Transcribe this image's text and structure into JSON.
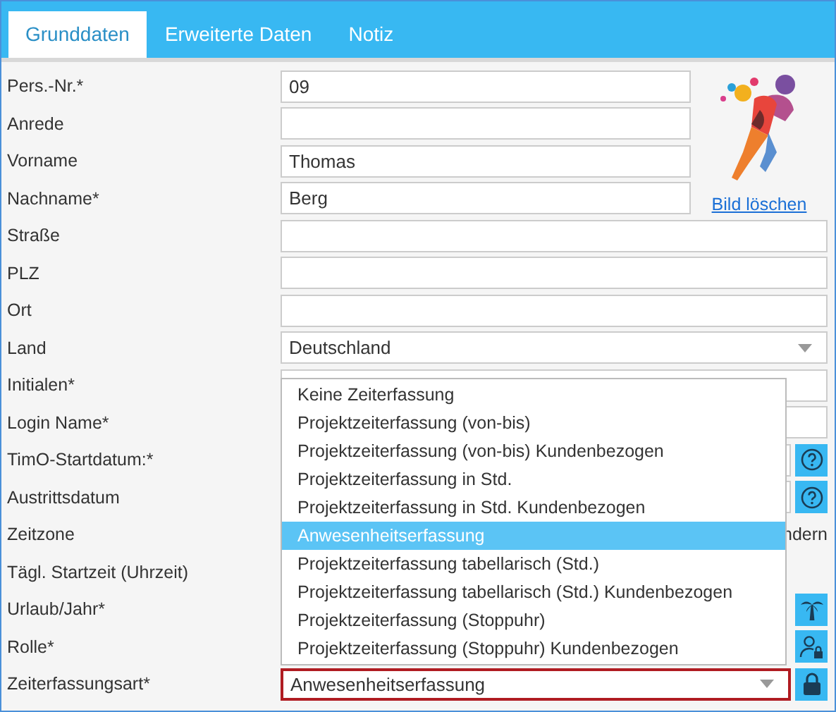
{
  "tabs": [
    {
      "label": "Grunddaten",
      "selected": true
    },
    {
      "label": "Erweiterte Daten",
      "selected": false
    },
    {
      "label": "Notiz",
      "selected": false
    }
  ],
  "header_fields": [
    {
      "label": "Pers.-Nr.*",
      "kind": "text",
      "value": "09"
    },
    {
      "label": "Anrede",
      "kind": "text"
    },
    {
      "label": "Vorname",
      "kind": "text",
      "value": "Thomas"
    },
    {
      "label": "Nachname*",
      "kind": "text",
      "value": "Berg"
    }
  ],
  "photo": {
    "kind": "picture",
    "link": "Bild löschen"
  },
  "fields": [
    {
      "label": "Straße",
      "kind": "text"
    },
    {
      "label": "PLZ",
      "kind": "text"
    },
    {
      "label": "Ort",
      "kind": "text"
    },
    {
      "label": "Land",
      "kind": "select",
      "value": "Deutschland"
    },
    {
      "label": "Initialen*",
      "kind": "text"
    },
    {
      "label": "Login Name*",
      "kind": "text"
    },
    {
      "label": "TimO-Startdatum:*",
      "kind": "text",
      "button": {
        "kind": "help"
      }
    },
    {
      "label": "Austrittsdatum",
      "kind": "text",
      "button": {
        "kind": "help"
      }
    },
    {
      "label": "Zeitzone",
      "kind": "note",
      "note": "ndern"
    },
    {
      "label": "Tägl. Startzeit (Uhrzeit)",
      "kind": "empty"
    },
    {
      "label": "Urlaub/Jahr*",
      "kind": "empty",
      "button": {
        "kind": "palm"
      }
    },
    {
      "label": "Rolle*",
      "kind": "empty",
      "button": {
        "kind": "user-lock"
      }
    },
    {
      "label": "Zeiterfassungsart*",
      "kind": "select",
      "value": "Anwesenheitserfassung",
      "focused": true,
      "button": {
        "kind": "lock"
      },
      "dropdown": [
        {
          "label": "Keine Zeiterfassung",
          "selected": false
        },
        {
          "label": "Projektzeiterfassung (von-bis)",
          "selected": false
        },
        {
          "label": "Projektzeiterfassung (von-bis) Kundenbezogen",
          "selected": false
        },
        {
          "label": "Projektzeiterfassung in Std.",
          "selected": false
        },
        {
          "label": "Projektzeiterfassung in Std. Kundenbezogen",
          "selected": false
        },
        {
          "label": "Anwesenheitserfassung",
          "selected": true
        },
        {
          "label": "Projektzeiterfassung tabellarisch (Std.)",
          "selected": false
        },
        {
          "label": "Projektzeiterfassung tabellarisch (Std.) Kundenbezogen",
          "selected": false
        },
        {
          "label": "Projektzeiterfassung (Stoppuhr)",
          "selected": false
        },
        {
          "label": "Projektzeiterfassung (Stoppuhr) Kundenbezogen",
          "selected": false
        }
      ]
    }
  ]
}
